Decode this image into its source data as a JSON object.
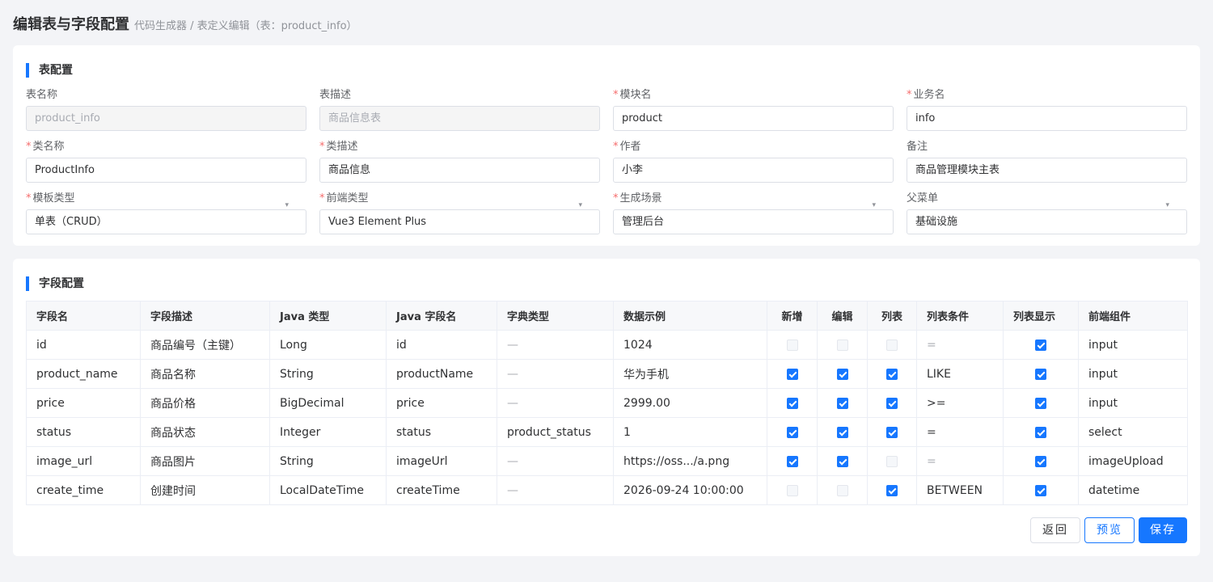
{
  "header": {
    "title": "编辑表与字段配置",
    "breadcrumb": "代码生成器 / 表定义编辑（表：product_info）"
  },
  "table_config": {
    "section_title": "表配置",
    "fields": [
      {
        "label": "表名称",
        "required": false,
        "value": "product_info",
        "disabled": true,
        "select": false
      },
      {
        "label": "表描述",
        "required": false,
        "value": "商品信息表",
        "disabled": true,
        "select": false
      },
      {
        "label": "模块名",
        "required": true,
        "value": "product",
        "disabled": false,
        "select": false
      },
      {
        "label": "业务名",
        "required": true,
        "value": "info",
        "disabled": false,
        "select": false
      },
      {
        "label": "类名称",
        "required": true,
        "value": "ProductInfo",
        "disabled": false,
        "select": false
      },
      {
        "label": "类描述",
        "required": true,
        "value": "商品信息",
        "disabled": false,
        "select": false
      },
      {
        "label": "作者",
        "required": true,
        "value": "小李",
        "disabled": false,
        "select": false
      },
      {
        "label": "备注",
        "required": false,
        "value": "商品管理模块主表",
        "disabled": false,
        "select": false
      },
      {
        "label": "模板类型",
        "required": true,
        "value": "单表（CRUD）",
        "disabled": false,
        "select": true
      },
      {
        "label": "前端类型",
        "required": true,
        "value": "Vue3 Element Plus",
        "disabled": false,
        "select": true
      },
      {
        "label": "生成场景",
        "required": true,
        "value": "管理后台",
        "disabled": false,
        "select": true
      },
      {
        "label": "父菜单",
        "required": false,
        "value": "基础设施",
        "disabled": false,
        "select": true
      }
    ]
  },
  "field_config": {
    "section_title": "字段配置",
    "columns": [
      "字段名",
      "字段描述",
      "Java 类型",
      "Java 字段名",
      "字典类型",
      "数据示例",
      "新增",
      "编辑",
      "列表",
      "列表条件",
      "列表显示",
      "前端组件"
    ],
    "rows": [
      {
        "name": "id",
        "desc": "商品编号（主键）",
        "java_type": "Long",
        "java_field": "id",
        "dict": "—",
        "example": "1024",
        "create": false,
        "edit": false,
        "list": false,
        "condition": "=",
        "condition_muted": true,
        "list_show": true,
        "component": "input"
      },
      {
        "name": "product_name",
        "desc": "商品名称",
        "java_type": "String",
        "java_field": "productName",
        "dict": "—",
        "example": "华为手机",
        "create": true,
        "edit": true,
        "list": true,
        "condition": "LIKE",
        "condition_muted": false,
        "list_show": true,
        "component": "input"
      },
      {
        "name": "price",
        "desc": "商品价格",
        "java_type": "BigDecimal",
        "java_field": "price",
        "dict": "—",
        "example": "2999.00",
        "create": true,
        "edit": true,
        "list": true,
        "condition": ">=",
        "condition_muted": false,
        "list_show": true,
        "component": "input"
      },
      {
        "name": "status",
        "desc": "商品状态",
        "java_type": "Integer",
        "java_field": "status",
        "dict": "product_status",
        "example": "1",
        "create": true,
        "edit": true,
        "list": true,
        "condition": "=",
        "condition_muted": false,
        "list_show": true,
        "component": "select"
      },
      {
        "name": "image_url",
        "desc": "商品图片",
        "java_type": "String",
        "java_field": "imageUrl",
        "dict": "—",
        "example": "https://oss.../a.png",
        "create": true,
        "edit": true,
        "list": false,
        "condition": "=",
        "condition_muted": true,
        "list_show": true,
        "component": "imageUpload"
      },
      {
        "name": "create_time",
        "desc": "创建时间",
        "java_type": "LocalDateTime",
        "java_field": "createTime",
        "dict": "—",
        "example": "2026-09-24 10:00:00",
        "create": false,
        "edit": false,
        "list": true,
        "condition": "BETWEEN",
        "condition_muted": false,
        "list_show": true,
        "component": "datetime"
      }
    ]
  },
  "actions": {
    "back_label": "返回",
    "preview_label": "预览",
    "save_label": "保存"
  },
  "colors": {
    "accent": "#1677ff",
    "required": "#f56c6c",
    "background": "#f3f4f7"
  }
}
